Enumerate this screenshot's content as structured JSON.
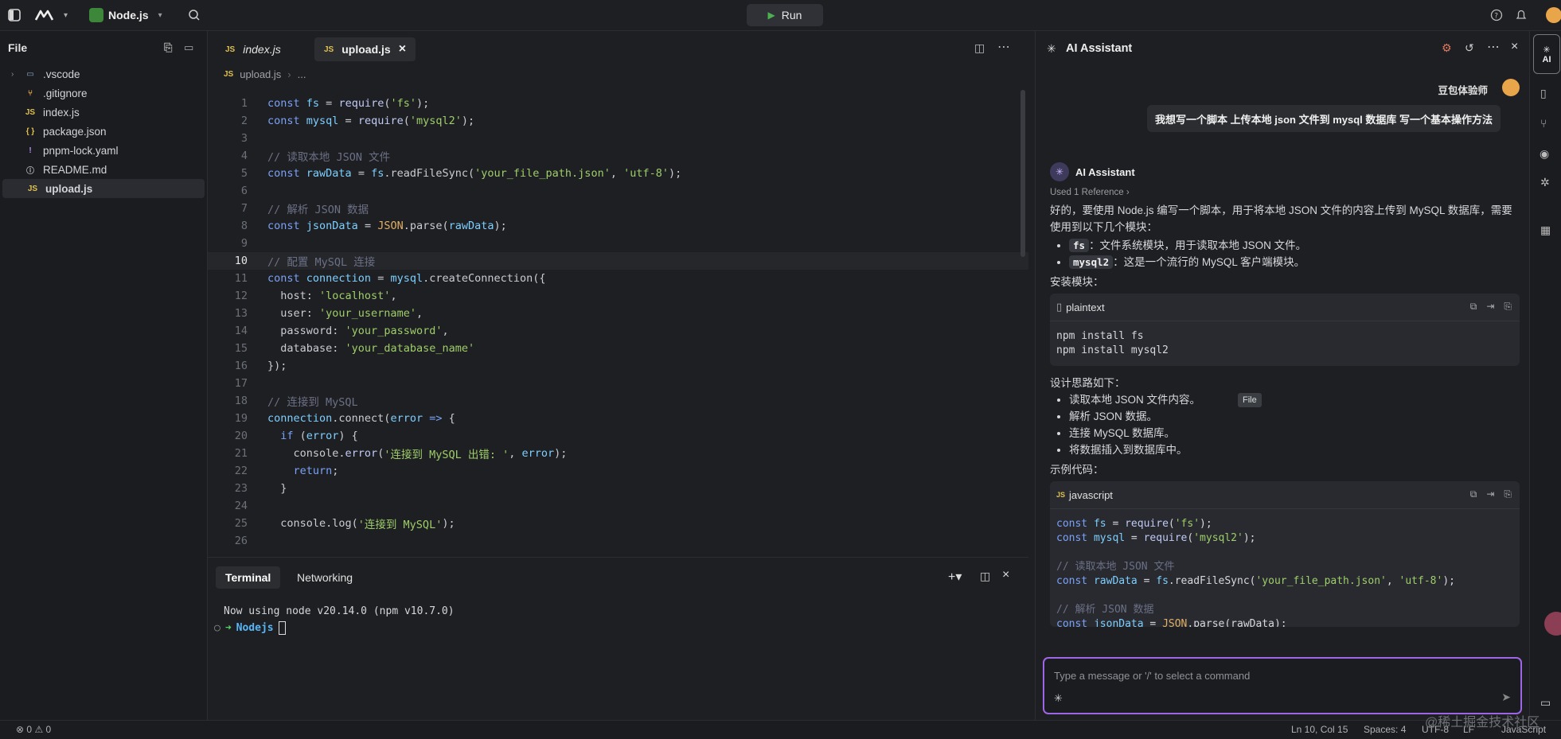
{
  "topbar": {
    "project": "Node.js",
    "run_label": "Run"
  },
  "sidebar": {
    "title": "File",
    "items": [
      {
        "label": ".vscode",
        "icon": "folder-icon",
        "expandable": true
      },
      {
        "label": ".gitignore",
        "icon": "git-icon"
      },
      {
        "label": "index.js",
        "icon": "JS"
      },
      {
        "label": "package.json",
        "icon": "{ }"
      },
      {
        "label": "pnpm-lock.yaml",
        "icon": "!"
      },
      {
        "label": "README.md",
        "icon": "info-icon"
      },
      {
        "label": "upload.js",
        "icon": "JS",
        "active": true
      }
    ]
  },
  "editor": {
    "tabs": [
      {
        "badge": "JS",
        "label": "index.js"
      },
      {
        "badge": "JS",
        "label": "upload.js",
        "close": "×"
      }
    ],
    "breadcrumb": {
      "badge": "JS",
      "file": "upload.js",
      "more": "..."
    },
    "highlighted_line": 10
  },
  "terminal": {
    "tabs": [
      "Terminal",
      "Networking"
    ],
    "line1": "Now using node v20.14.0 (npm v10.7.0)",
    "prompt_arrow": "➜",
    "prompt_dir": "Nodejs"
  },
  "ai": {
    "title": "AI Assistant",
    "user_name": "豆包体验师",
    "user_message": "我想写一个脚本  上传本地 json 文件到 mysql 数据库 写一个基本操作方法",
    "assistant_name": "AI Assistant",
    "used_reference": "Used 1 Reference",
    "intro": "好的，要使用 Node.js 编写一个脚本，用于将本地 JSON 文件的内容上传到 MySQL 数据库，需要使用到以下几个模块：",
    "modules": [
      {
        "code": "fs",
        "text": "：文件系统模块，用于读取本地 JSON 文件。"
      },
      {
        "code": "mysql2",
        "text": "：这是一个流行的 MySQL 客户端模块。"
      }
    ],
    "install_heading": "安装模块：",
    "block1_lang": "plaintext",
    "block1_code": "npm install fs\nnpm install mysql2",
    "design_heading": "设计思路如下：",
    "steps": [
      "读取本地 JSON 文件内容。",
      "解析 JSON 数据。",
      "连接 MySQL 数据库。",
      "将数据插入到数据库中。"
    ],
    "example_heading": "示例代码：",
    "block2_lang": "javascript",
    "input_placeholder": "Type a message or '/' to select a command",
    "tooltip": "File"
  },
  "status": {
    "errors": "0",
    "warnings": "0",
    "position": "Ln 10, Col 15",
    "spaces": "Spaces: 4",
    "encoding": "UTF-8",
    "eol": "LF",
    "language": "JavaScript",
    "watermark": "@稀土掘金技术社区"
  }
}
